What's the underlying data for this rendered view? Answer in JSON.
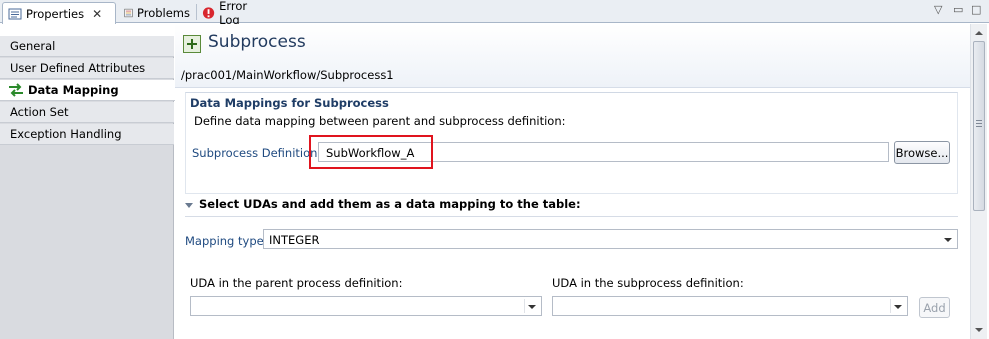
{
  "tabs": [
    {
      "label": "Properties",
      "icon": "properties-icon",
      "active": true,
      "close": "✕"
    },
    {
      "label": "Problems",
      "icon": "problems-icon",
      "active": false
    },
    {
      "label": "Error Log",
      "icon": "error-log-icon",
      "active": false
    }
  ],
  "window_controls": {
    "menu": "▽",
    "minimize": "▭",
    "maximize": "□"
  },
  "nav": {
    "items": [
      {
        "label": "General"
      },
      {
        "label": "User Defined Attributes"
      },
      {
        "label": "Data Mapping",
        "active": true
      },
      {
        "label": "Action Set"
      },
      {
        "label": "Exception Handling"
      }
    ]
  },
  "header": {
    "title": "Subprocess",
    "path": "/prac001/MainWorkflow/Subprocess1"
  },
  "data_mappings": {
    "title": "Data Mappings for Subprocess",
    "description": "Define data mapping between parent and subprocess definition:",
    "definition_label": "Subprocess Definition:",
    "definition_value": "SubWorkflow_A",
    "browse_label": "Browse..."
  },
  "uda_section": {
    "title": "Select UDAs and add them as a data mapping to the table:",
    "mapping_type_label": "Mapping type",
    "mapping_type_value": "INTEGER",
    "parent_label": "UDA in the parent process definition:",
    "parent_value": "",
    "sub_label": "UDA in the subprocess definition:",
    "sub_value": "",
    "add_label": "Add"
  },
  "colors": {
    "highlight": "#e0141e",
    "title": "#223b5f",
    "label": "#1f4a80",
    "nav_bg": "#d9dbe0"
  }
}
